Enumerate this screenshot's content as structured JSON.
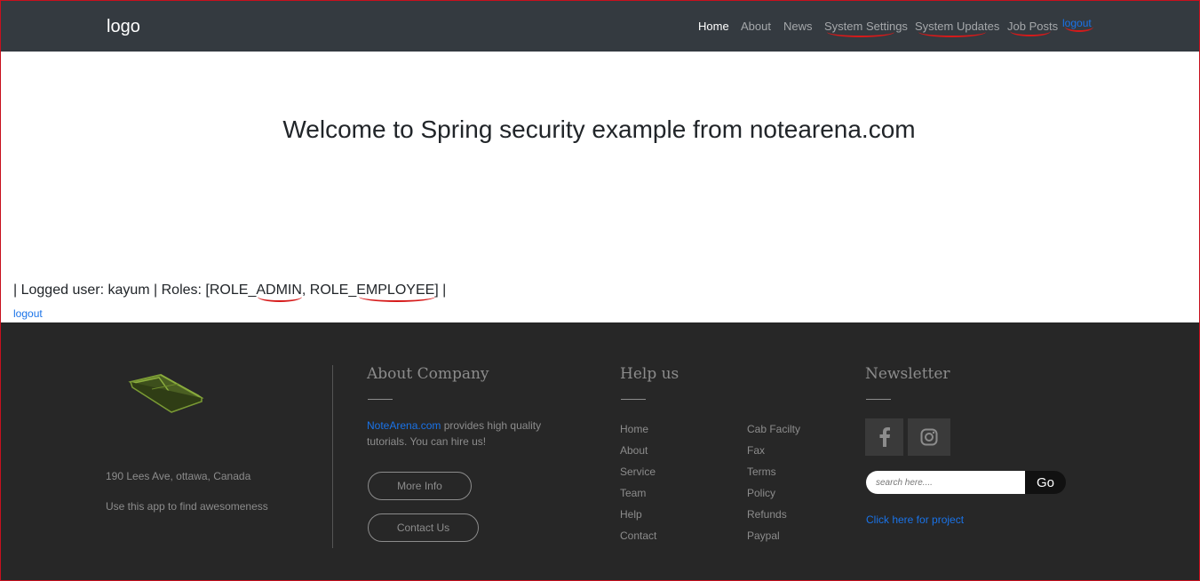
{
  "navbar": {
    "brand": "logo",
    "links": [
      {
        "label": "Home"
      },
      {
        "label": "About"
      },
      {
        "label": "News"
      },
      {
        "label": "System Settings"
      },
      {
        "label": "System Updates"
      },
      {
        "label": "Job Posts"
      }
    ],
    "logout": "logout"
  },
  "main": {
    "title": "Welcome to Spring security example from notearena.com",
    "user_line": "| Logged user: kayum | Roles: [ROLE_ADMIN, ROLE_EMPLOYEE] |",
    "logout": "logout"
  },
  "footer": {
    "address": "190 Lees Ave, ottawa, Canada",
    "tagline": "Use this app to find awesomeness",
    "about": {
      "title": "About Company",
      "link_text": "NoteArena.com",
      "text": " provides high quality tutorials. You can hire us!",
      "more_info": "More Info",
      "contact_us": "Contact Us"
    },
    "help": {
      "title": "Help us",
      "col1": [
        "Home",
        "About",
        "Service",
        "Team",
        "Help",
        "Contact"
      ],
      "col2": [
        "Cab Facilty",
        "Fax",
        "Terms",
        "Policy",
        "Refunds",
        "Paypal"
      ]
    },
    "newsletter": {
      "title": "Newsletter",
      "search_placeholder": "search here....",
      "go": "Go",
      "project_link": "Click here for project"
    }
  },
  "colors": {
    "navbar_bg": "#343a40",
    "footer_bg": "#272727",
    "link_blue": "#1a73e8",
    "annotation_red": "#d61a1a"
  }
}
